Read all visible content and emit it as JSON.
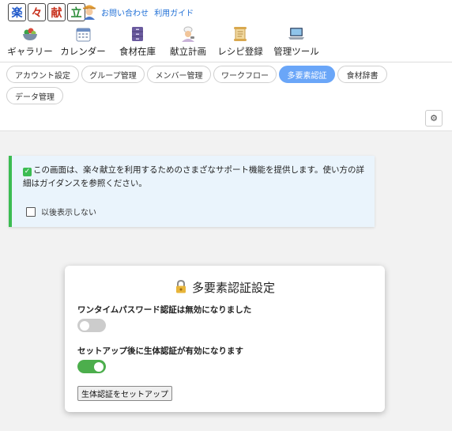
{
  "app": {
    "logo_chars": [
      "楽",
      "々",
      "献",
      "立"
    ],
    "links": [
      "お問い合わせ",
      "利用ガイド"
    ]
  },
  "nav": [
    {
      "label": "ギャラリー",
      "icon": "salad-bowl-icon"
    },
    {
      "label": "カレンダー",
      "icon": "calendar-icon"
    },
    {
      "label": "食材在庫",
      "icon": "cabinet-icon"
    },
    {
      "label": "献立計画",
      "icon": "cook-icon"
    },
    {
      "label": "レシピ登録",
      "icon": "scroll-icon"
    },
    {
      "label": "管理ツール",
      "icon": "laptop-icon"
    }
  ],
  "tabs": [
    {
      "label": "アカウント設定",
      "active": false
    },
    {
      "label": "グループ管理",
      "active": false
    },
    {
      "label": "メンバー管理",
      "active": false
    },
    {
      "label": "ワークフロー",
      "active": false
    },
    {
      "label": "多要素認証",
      "active": true
    },
    {
      "label": "食材辞書",
      "active": false
    },
    {
      "label": "データ管理",
      "active": false
    }
  ],
  "settings_icon": "⚙",
  "notice": {
    "text": "この画面は、楽々献立を利用するためのさまざなサポート機能を提供します。使い方の詳細はガイダンスを参照ください。",
    "dont_show_label": "以後表示しない",
    "dont_show_checked": false
  },
  "mfa": {
    "title": "多要素認証設定",
    "otp_label": "ワンタイムパスワード認証は無効になりました",
    "otp_enabled": false,
    "bio_label": "セットアップ後に生体認証が有効になります",
    "bio_enabled": true,
    "setup_button": "生体認証をセットアップ"
  },
  "colors": {
    "active_tab": "#6aa6f8",
    "toggle_on": "#4cae4c",
    "notice_accent": "#3cbc52",
    "link": "#1f6fd6"
  }
}
